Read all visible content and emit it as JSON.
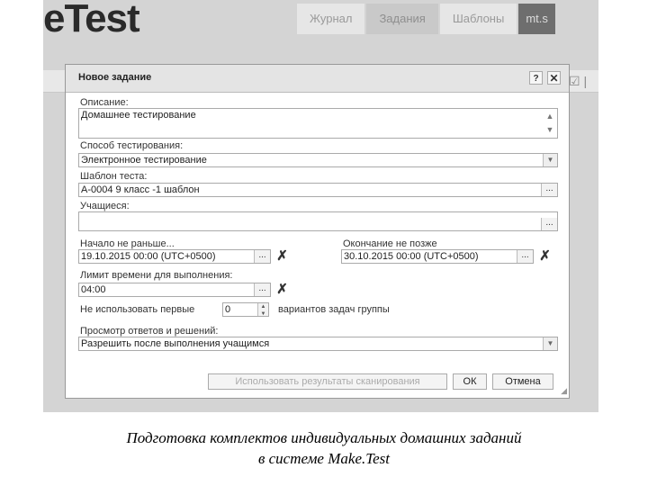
{
  "app": {
    "logo_text": "eTest"
  },
  "nav": {
    "tabs": [
      "Журнал",
      "Задания",
      "Шаблоны",
      "mt.s"
    ]
  },
  "dialog": {
    "title": "Новое задание",
    "help_label": "?",
    "close_label": "✕",
    "description": {
      "label": "Описание:",
      "value": "Домашнее тестирование"
    },
    "method": {
      "label": "Способ тестирования:",
      "value": "Электронное тестирование"
    },
    "template": {
      "label": "Шаблон теста:",
      "value": "А-0004 9 класс -1 шаблон"
    },
    "students": {
      "label": "Учащиеся:",
      "value": ""
    },
    "start": {
      "label": "Начало не раньше...",
      "value": "19.10.2015 00:00 (UTC+0500)"
    },
    "end": {
      "label": "Окончание не позже",
      "value": "30.10.2015 00:00 (UTC+0500)"
    },
    "time_limit": {
      "label": "Лимит времени для выполнения:",
      "value": "04:00"
    },
    "variants": {
      "label_before": "Не использовать первые",
      "value": "0",
      "label_after": "вариантов задач группы"
    },
    "review": {
      "label": "Просмотр ответов и решений:",
      "value": "Разрешить после выполнения учащимся"
    },
    "buttons": {
      "scan": "Использовать результаты сканирования",
      "ok": "ОК",
      "cancel": "Отмена"
    }
  },
  "caption": {
    "line1": "Подготовка комплектов индивидуальных домашних заданий",
    "line2": "в системе Make.Test"
  }
}
